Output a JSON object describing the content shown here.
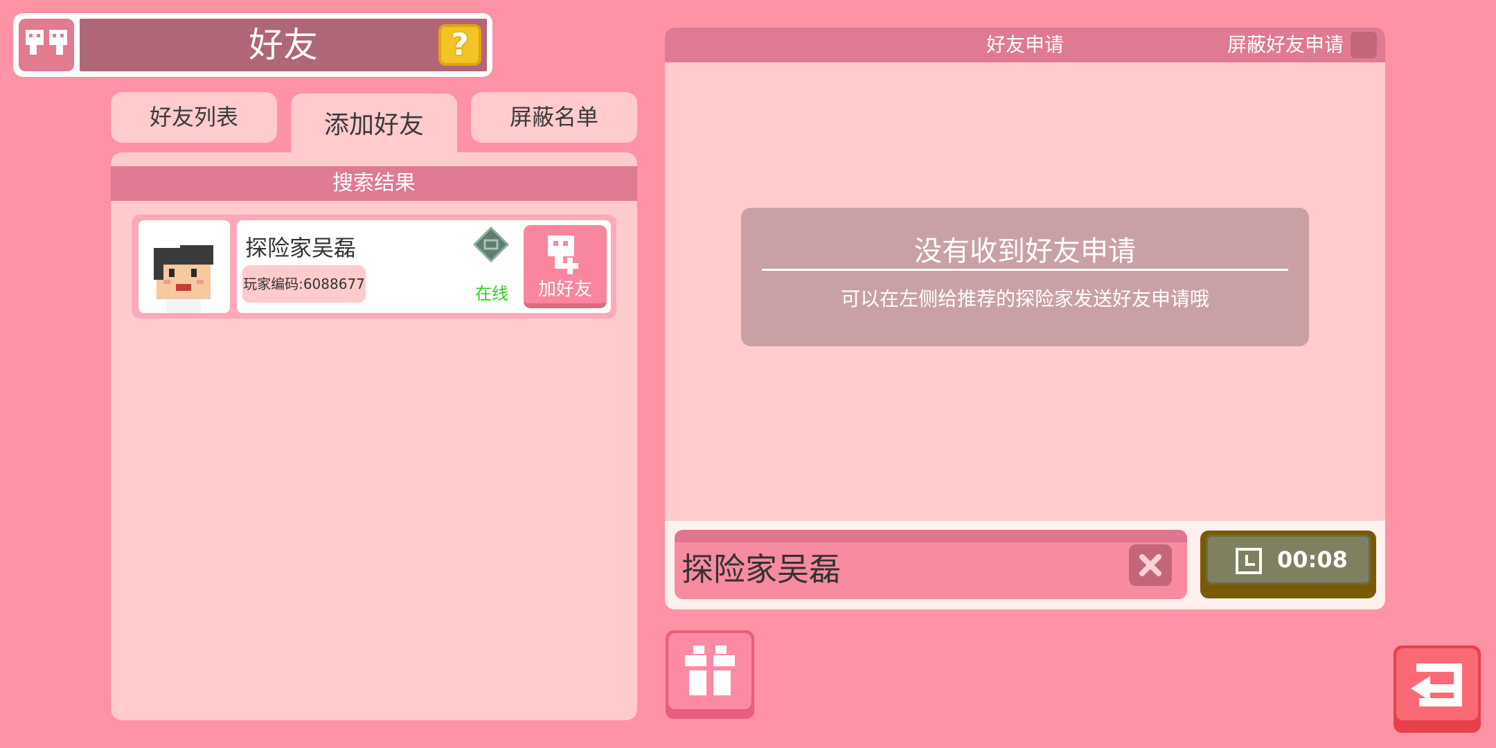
{
  "header": {
    "title": "好友",
    "icon": "friends-icon",
    "help_icon": "question-mark-icon",
    "help_label": "?"
  },
  "tabs": [
    {
      "label": "好友列表",
      "active": false
    },
    {
      "label": "添加好友",
      "active": true
    },
    {
      "label": "屏蔽名单",
      "active": false
    }
  ],
  "search": {
    "header": "搜索结果",
    "results": [
      {
        "name": "探险家吴磊",
        "code": "玩家编码:6088677",
        "status": "在线",
        "status_icon": "connection-diamond-icon",
        "add_label": "加好友",
        "add_icon": "add-friend-icon"
      }
    ]
  },
  "requests": {
    "title": "好友申请",
    "block_label": "屏蔽好友申请",
    "empty_title": "没有收到好友申请",
    "empty_sub": "可以在左侧给推荐的探险家发送好友申请哦"
  },
  "name_field": {
    "value": "探险家吴磊",
    "clear_icon": "close-x-icon"
  },
  "timer": {
    "value": "00:08",
    "icon": "clock-icon"
  },
  "buttons": {
    "gift_icon": "gift-icon",
    "back_icon": "back-arrow-icon"
  },
  "colors": {
    "background": "#ff92a4",
    "panel": "#ffcbcd",
    "header_bar": "#b06676",
    "section_header": "#e07a92",
    "online_green": "#2bd11a",
    "help_yellow": "#f2c425",
    "back_red": "#e8404b"
  }
}
